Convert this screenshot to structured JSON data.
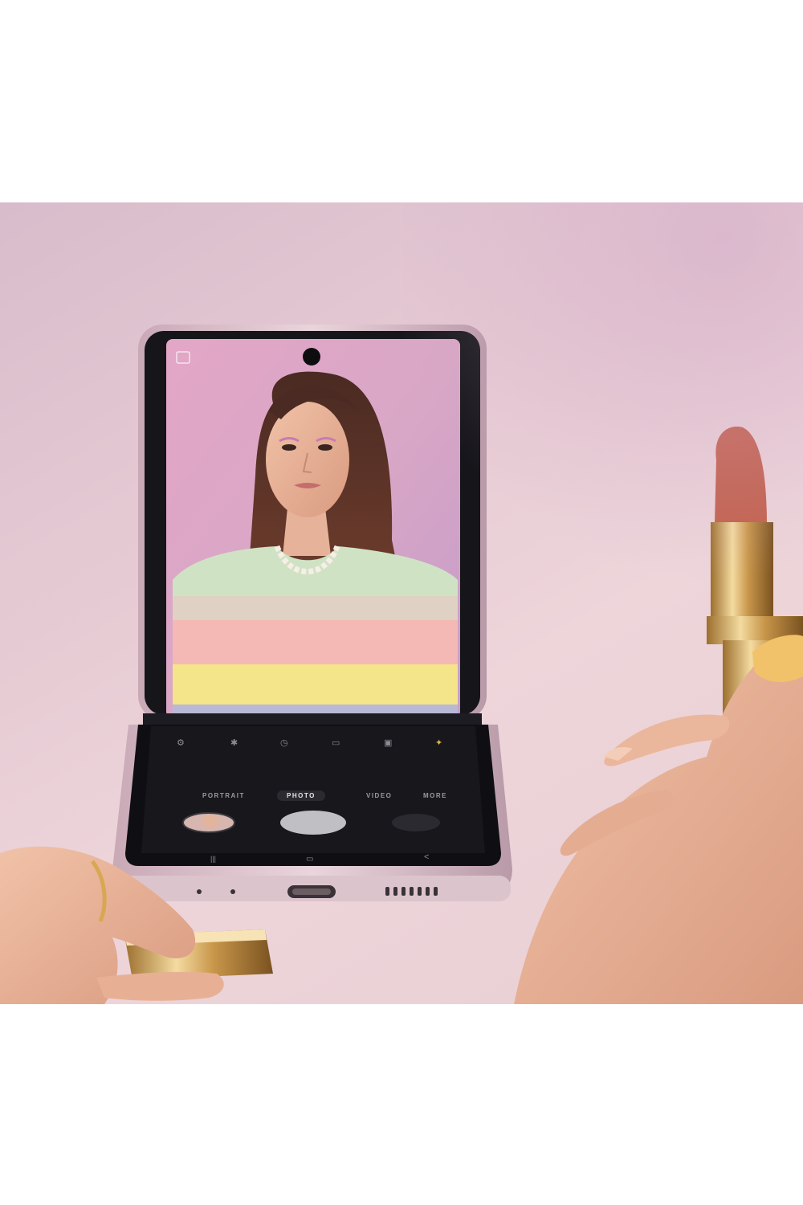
{
  "scene": {
    "description_alt": "",
    "background_color": "#e6cad3",
    "phone_frame_color": "#d9bcc8"
  },
  "camera_app": {
    "modes": [
      "PORTRAIT",
      "PHOTO",
      "VIDEO",
      "MORE"
    ],
    "active_mode": "PHOTO",
    "top_icons": [
      "settings-icon",
      "flash-icon",
      "timer-icon",
      "aspect-ratio-icon",
      "motion-photo-icon",
      "filter-icon"
    ],
    "nav_icons": [
      "recent-apps-icon",
      "home-icon",
      "back-icon"
    ]
  }
}
